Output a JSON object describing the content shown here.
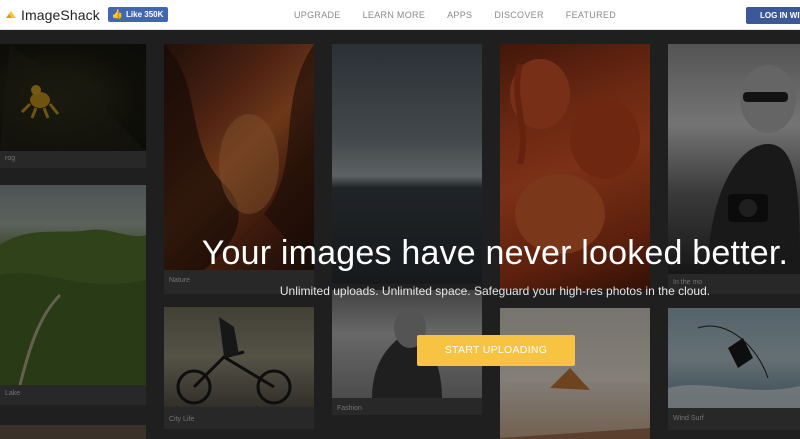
{
  "brand": {
    "name": "ImageShack",
    "accent": "#f6c342"
  },
  "facebook": {
    "like_label": "Like 350K",
    "thumb_icon": "thumbs-up-icon"
  },
  "nav": {
    "links": [
      "UPGRADE",
      "LEARN MORE",
      "APPS",
      "DISCOVER",
      "FEATURED"
    ],
    "login_label": "LOG IN WIT"
  },
  "hero": {
    "title": "Your images have never looked better.",
    "subtitle": "Unlimited uploads. Unlimited space. Safeguard your high-res photos in the cloud.",
    "cta_label": "START UPLOADING"
  },
  "gallery": {
    "captions": {
      "frog": "rog",
      "nature": "Nature",
      "lake": "Lake",
      "city_life": "City Life",
      "fashion": "Fashion",
      "wind_surf": "Wind Surf",
      "in_the_moment": "In the mo"
    }
  }
}
